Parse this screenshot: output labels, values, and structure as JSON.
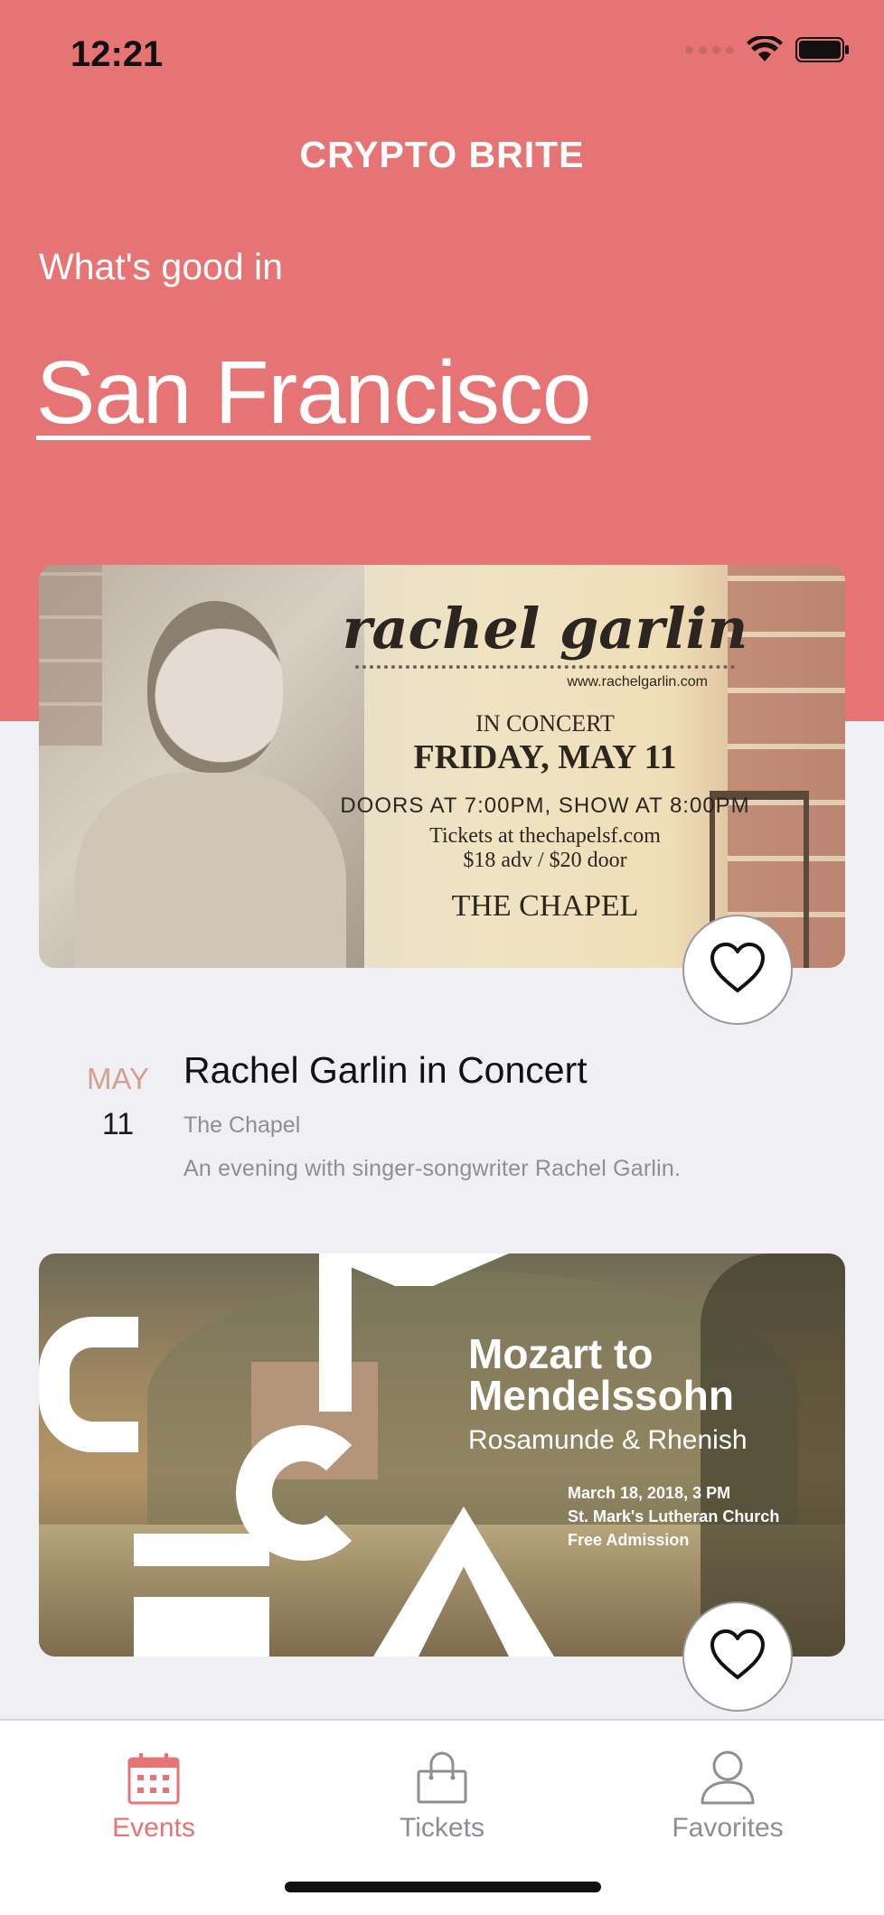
{
  "status_bar": {
    "time": "12:21"
  },
  "header": {
    "app_title": "CRYPTO BRITE",
    "subtitle": "What's good in",
    "city": "San Francisco"
  },
  "events": [
    {
      "month": "MAY",
      "day": "11",
      "title": "Rachel Garlin in Concert",
      "venue": "The Chapel",
      "description": "An evening with singer-songwriter Rachel Garlin.",
      "poster": {
        "name": "rachel garlin",
        "url": "www.rachelgarlin.com",
        "line1": "IN CONCERT",
        "line2": "FRIDAY, MAY 11",
        "line3": "DOORS AT 7:00PM, SHOW AT 8:00PM",
        "line4": "Tickets at thechapelsf.com",
        "line5": "$18 adv / $20 door",
        "line6": "THE CHAPEL"
      }
    },
    {
      "poster": {
        "title_line1": "Mozart to",
        "title_line2": "Mendelssohn",
        "subtitle": "Rosamunde & Rhenish",
        "date": "March 18, 2018, 3 PM",
        "venue": "St. Mark's Lutheran Church",
        "admission": "Free Admission"
      }
    }
  ],
  "tab_bar": {
    "tabs": [
      {
        "label": "Events",
        "icon": "calendar-icon",
        "active": true
      },
      {
        "label": "Tickets",
        "icon": "shopping-bag-icon",
        "active": false
      },
      {
        "label": "Favorites",
        "icon": "person-icon",
        "active": false
      }
    ]
  },
  "colors": {
    "accent": "#e77475",
    "background": "#efeff4",
    "inactive_tab": "#8e8e93",
    "date_month": "#d2a28c"
  }
}
